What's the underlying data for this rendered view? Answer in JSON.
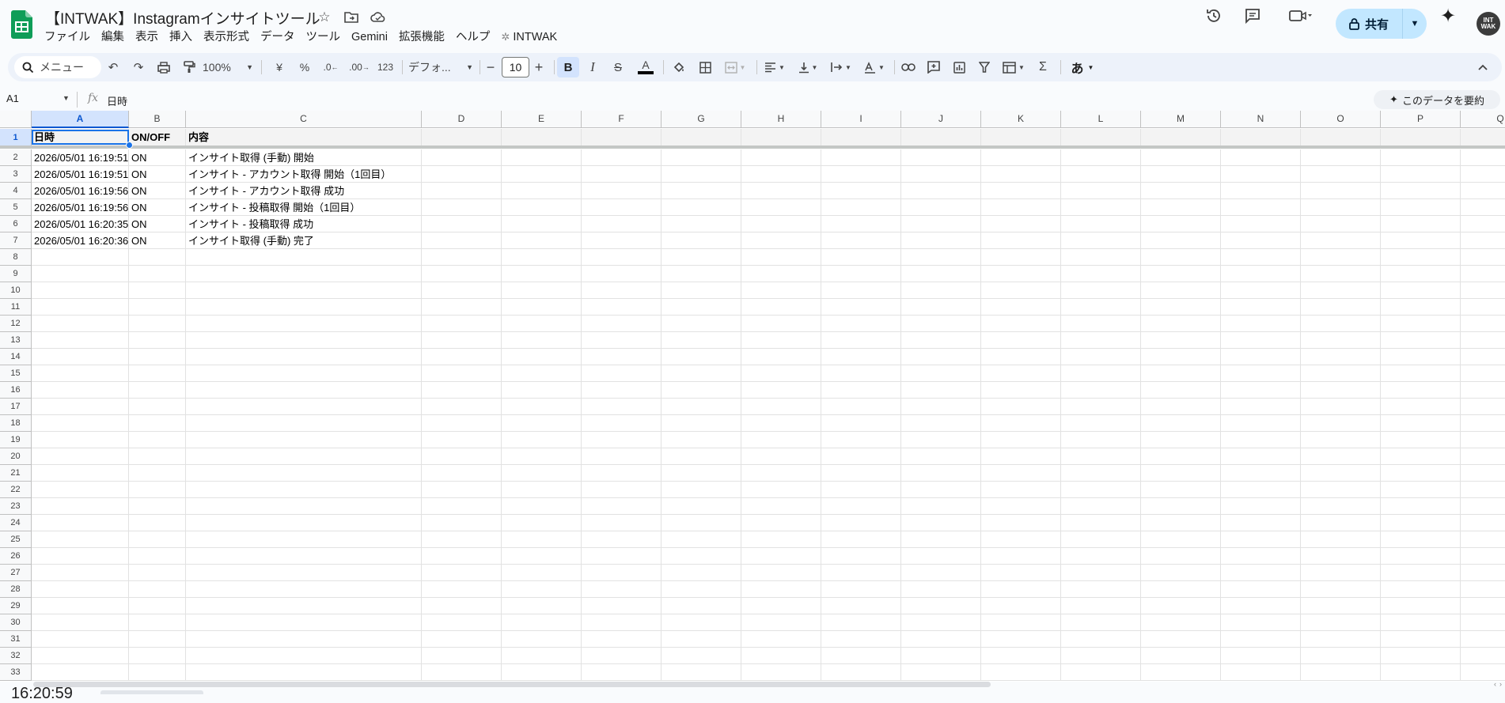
{
  "doc": {
    "title": "【INTWAK】Instagramインサイトツール"
  },
  "menu": [
    "ファイル",
    "編集",
    "表示",
    "挿入",
    "表示形式",
    "データ",
    "ツール",
    "Gemini",
    "拡張機能",
    "ヘルプ"
  ],
  "extension_menu": "INTWAK",
  "share": {
    "label": "共有"
  },
  "avatar": {
    "text": "INT WAK"
  },
  "toolbar": {
    "search_label": "メニュー",
    "zoom": "100%",
    "currency": "¥",
    "percent": "%",
    "dec_decrease": ".0",
    "dec_increase": ".00",
    "number_format": "123",
    "font": "デフォ...",
    "font_size": "10",
    "input_mode": "あ"
  },
  "formula_bar": {
    "cell_ref": "A1",
    "fx": "fx",
    "value": "日時"
  },
  "summarize": {
    "label": "このデータを要約"
  },
  "columns": [
    "A",
    "B",
    "C",
    "D",
    "E",
    "F",
    "G",
    "H",
    "I",
    "J",
    "K",
    "L",
    "M",
    "N",
    "O",
    "P",
    "Q"
  ],
  "rows": [
    {
      "num": "1",
      "cells": [
        "日時",
        "ON/OFF",
        "内容"
      ]
    },
    {
      "num": "2",
      "cells": [
        "2026/05/01 16:19:51",
        "ON",
        "インサイト取得 (手動) 開始"
      ]
    },
    {
      "num": "3",
      "cells": [
        "2026/05/01 16:19:51",
        "ON",
        "インサイト - アカウント取得 開始（1回目）"
      ]
    },
    {
      "num": "4",
      "cells": [
        "2026/05/01 16:19:56",
        "ON",
        "インサイト - アカウント取得 成功"
      ]
    },
    {
      "num": "5",
      "cells": [
        "2026/05/01 16:19:56",
        "ON",
        "インサイト - 投稿取得 開始（1回目）"
      ]
    },
    {
      "num": "6",
      "cells": [
        "2026/05/01 16:20:35",
        "ON",
        "インサイト - 投稿取得 成功"
      ]
    },
    {
      "num": "7",
      "cells": [
        "2026/05/01 16:20:36",
        "ON",
        "インサイト取得 (手動) 完了"
      ]
    },
    {
      "num": "8",
      "cells": []
    },
    {
      "num": "9",
      "cells": []
    },
    {
      "num": "10",
      "cells": []
    },
    {
      "num": "11",
      "cells": []
    },
    {
      "num": "12",
      "cells": []
    },
    {
      "num": "13",
      "cells": []
    },
    {
      "num": "14",
      "cells": []
    },
    {
      "num": "15",
      "cells": []
    },
    {
      "num": "16",
      "cells": []
    },
    {
      "num": "17",
      "cells": []
    },
    {
      "num": "18",
      "cells": []
    },
    {
      "num": "19",
      "cells": []
    },
    {
      "num": "20",
      "cells": []
    },
    {
      "num": "21",
      "cells": []
    },
    {
      "num": "22",
      "cells": []
    },
    {
      "num": "23",
      "cells": []
    },
    {
      "num": "24",
      "cells": []
    },
    {
      "num": "25",
      "cells": []
    },
    {
      "num": "26",
      "cells": []
    },
    {
      "num": "27",
      "cells": []
    },
    {
      "num": "28",
      "cells": []
    },
    {
      "num": "29",
      "cells": []
    },
    {
      "num": "30",
      "cells": []
    },
    {
      "num": "31",
      "cells": []
    },
    {
      "num": "32",
      "cells": []
    },
    {
      "num": "33",
      "cells": []
    }
  ],
  "status": {
    "clock": "16:20:59"
  },
  "colors": {
    "accent": "#0b57d0",
    "share_bg": "#c2e7ff",
    "toolbar_bg": "#edf2fa",
    "sheets_green": "#0f9d58"
  }
}
